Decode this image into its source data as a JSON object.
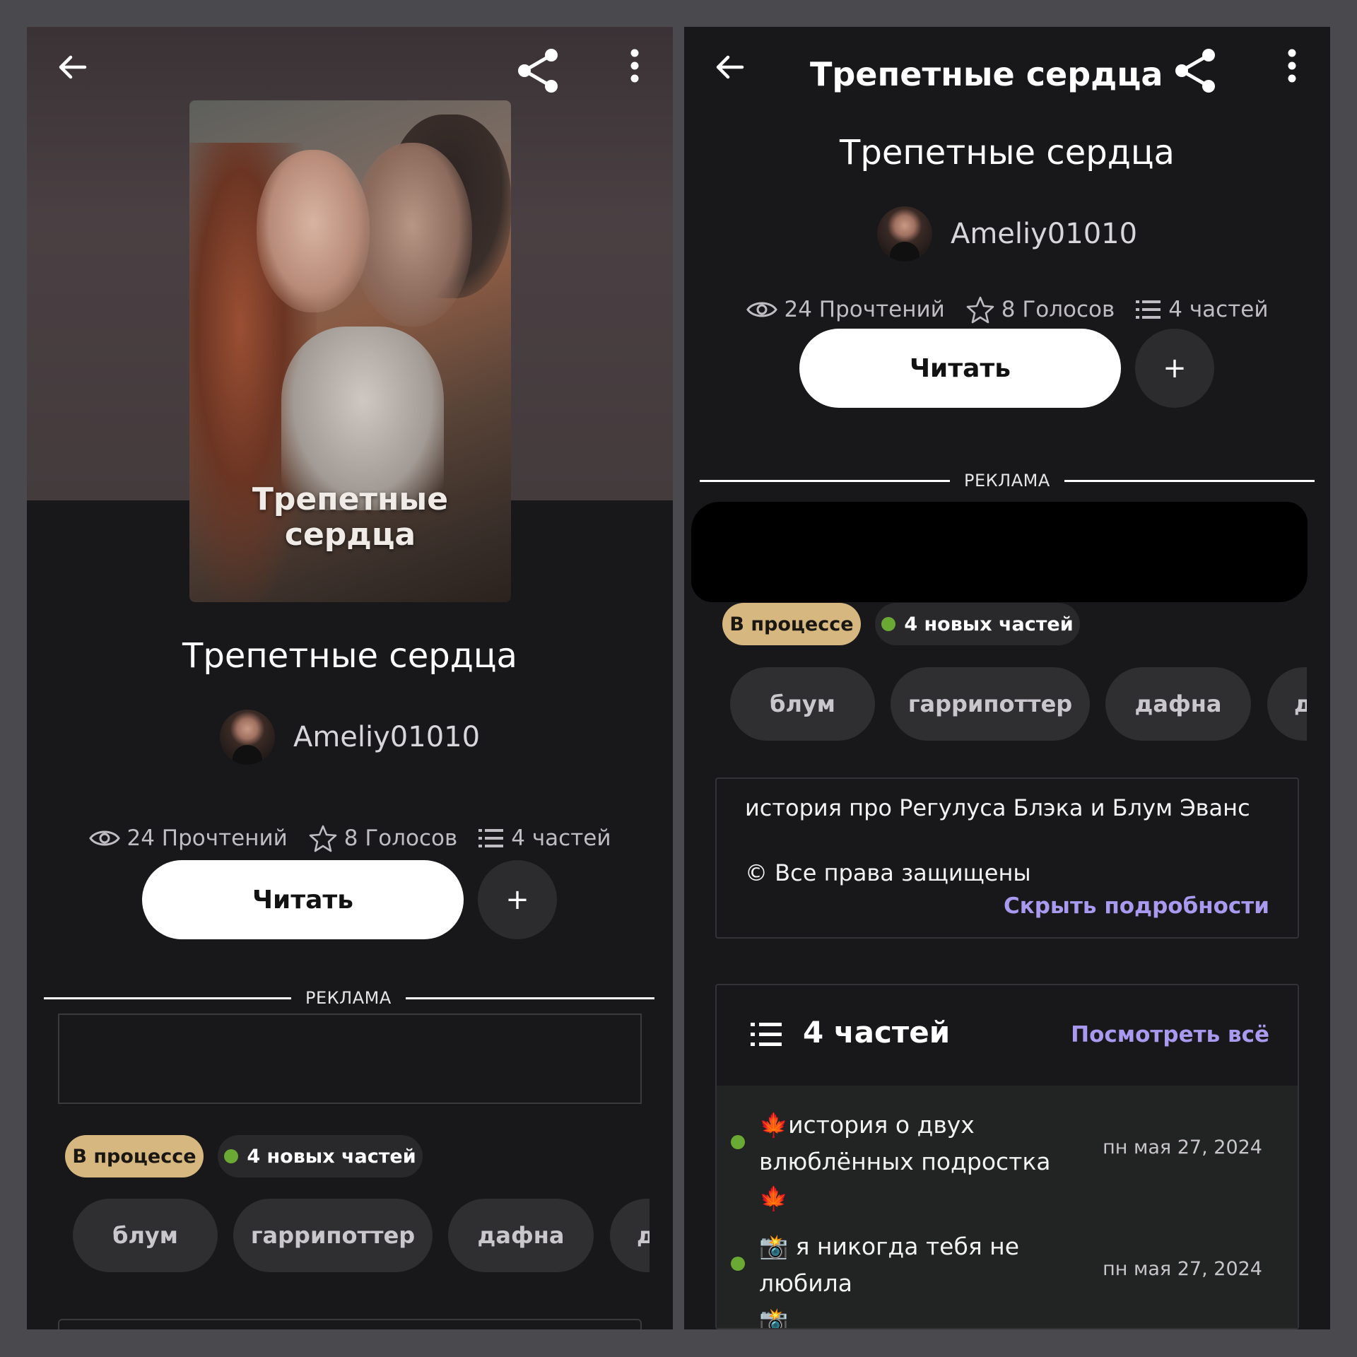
{
  "book": {
    "title": "Трепетные сердца",
    "cover_title_line1": "Трепетные",
    "cover_title_line2": "сердца",
    "author": "Ameliy01010",
    "stats": {
      "reads": "24 Прочтений",
      "votes": "8 Голосов",
      "parts": "4 частей"
    },
    "status": "В процессе",
    "new_parts": "4 новых частей",
    "tags": [
      "блум",
      "гаррипоттер",
      "дафна",
      "д"
    ],
    "description": "история про Регулуса Блэка и Блум Эванс",
    "copyright": "© Все права защищены"
  },
  "actions": {
    "read_label": "Читать",
    "add_label": "+",
    "hide_details": "Скрыть подробности",
    "view_all": "Посмотреть всё"
  },
  "ad_label": "РЕКЛАМА",
  "parts_section": {
    "title": "4 частей",
    "chapters": [
      {
        "leading_icon": "🍁",
        "line1": "история о двух",
        "line2": "влюблённых подростка",
        "trailing_icon": "🍁",
        "date": "пн мая 27, 2024"
      },
      {
        "leading_icon": "📸",
        "line1": "я никогда тебя не любила",
        "line2": "",
        "trailing_icon": "📸",
        "date": "пн мая 27, 2024"
      }
    ]
  },
  "icons": {
    "back": "arrow-left-icon",
    "share": "share-icon",
    "menu": "more-vertical-icon",
    "reads": "eye-icon",
    "votes": "star-icon",
    "parts": "list-icon"
  },
  "colors": {
    "background": "#18171a",
    "status_pill": "#d7b780",
    "accent_link": "#a99af0",
    "new_dot": "#6ba935"
  }
}
